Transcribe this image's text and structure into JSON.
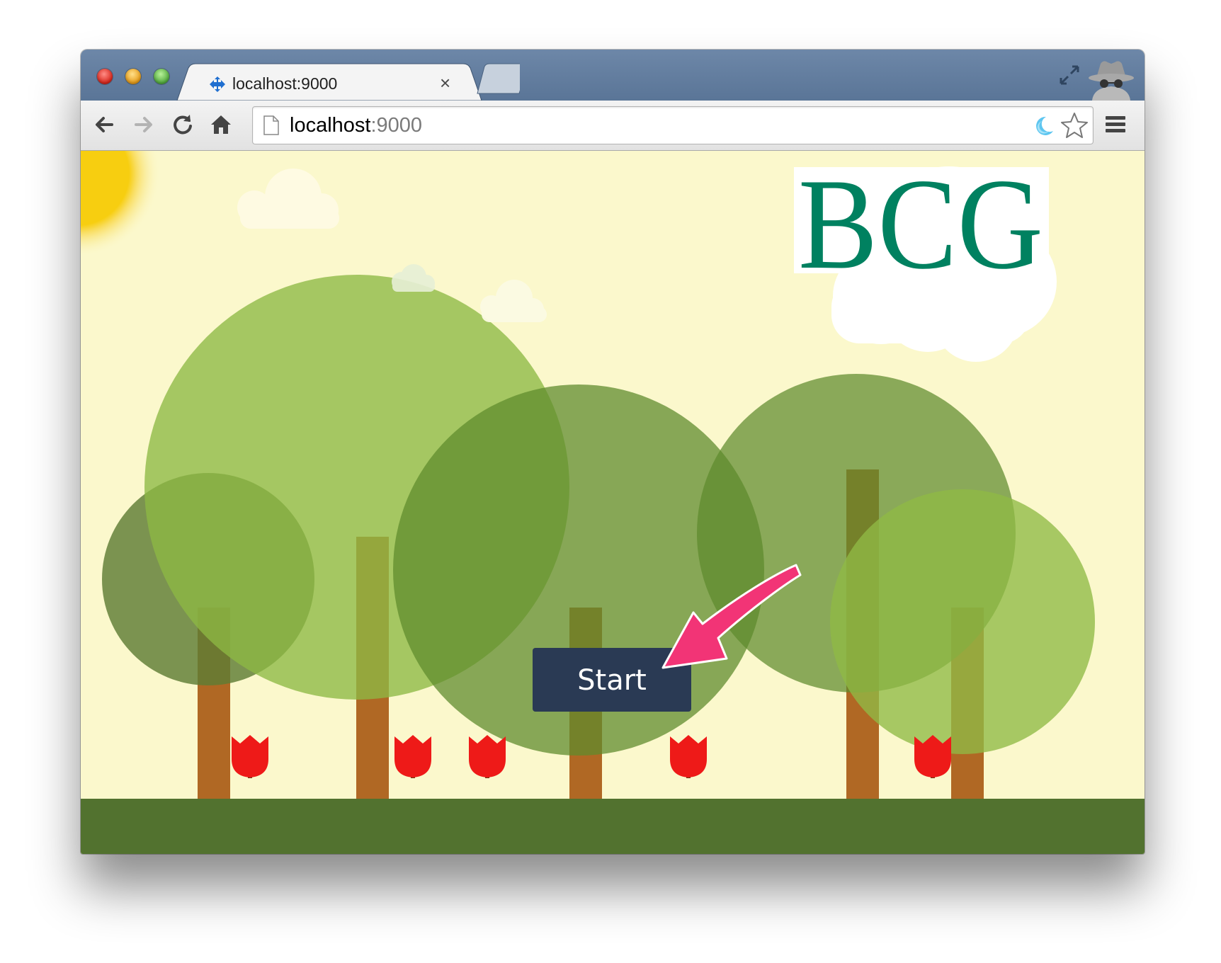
{
  "browser": {
    "tab": {
      "title": "localhost:9000",
      "close_glyph": "×",
      "favicon": "puzzle-arrows-icon"
    },
    "new_tab": "new-tab-button",
    "address_bar": {
      "host": "localhost",
      "port": ":9000"
    },
    "icons": [
      "back-arrow-icon",
      "forward-arrow-icon",
      "reload-icon",
      "home-icon",
      "page-icon",
      "extension-icon",
      "bookmark-star-icon",
      "menu-icon",
      "fullscreen-icon",
      "incognito-icon"
    ]
  },
  "page": {
    "logo_text": "BCG",
    "start_button": "Start",
    "colors": {
      "background": "#fbf8cc",
      "ground": "#52722f",
      "button": "#2a3a54",
      "logo": "#008160",
      "tulip": "#ee1a18",
      "trunk": "#b06824",
      "annotation_arrow": "#f23476",
      "sun": "#f7ce10"
    }
  }
}
